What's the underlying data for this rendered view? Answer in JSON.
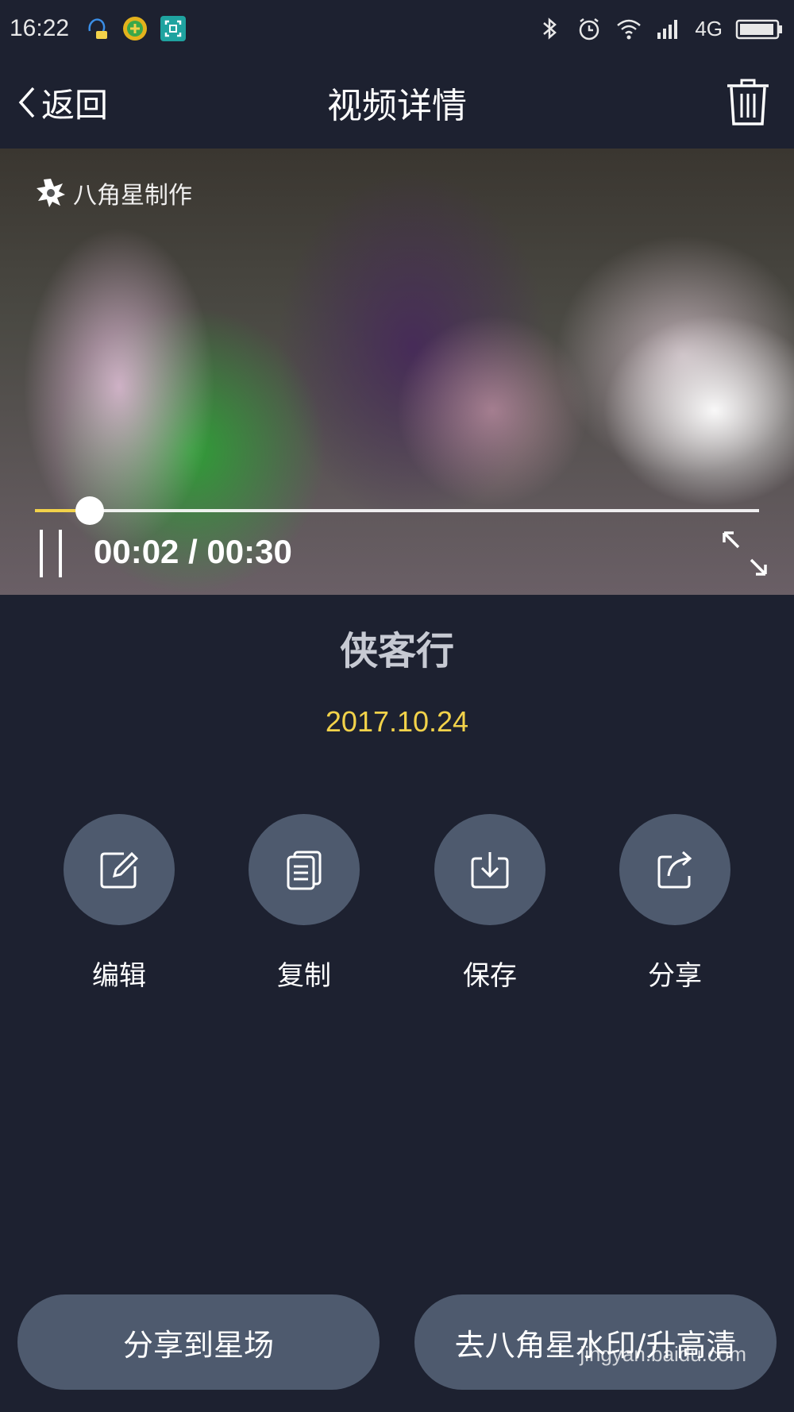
{
  "status_bar": {
    "time": "16:22",
    "left_icons": [
      "chat-bot-icon",
      "plus-app-icon",
      "scan-app-icon"
    ],
    "right_icons": [
      "bluetooth-icon",
      "alarm-icon",
      "wifi-icon",
      "signal-icon",
      "battery-icon"
    ],
    "network": "4G"
  },
  "header": {
    "back_label": "返回",
    "title": "视频详情"
  },
  "video": {
    "watermark": "八角星制作",
    "time_display": "00:02 / 00:30",
    "current": "00:02",
    "total": "00:30",
    "progress": 0.076
  },
  "clip": {
    "title": "侠客行",
    "date": "2017.10.24"
  },
  "actions": [
    {
      "label": "编辑",
      "icon": "edit-icon"
    },
    {
      "label": "复制",
      "icon": "copy-icon"
    },
    {
      "label": "保存",
      "icon": "download-icon"
    },
    {
      "label": "分享",
      "icon": "share-icon"
    }
  ],
  "bottom": {
    "share_plaza": "分享到星场",
    "remove_watermark": "去八角星水印/升高清"
  },
  "site_watermark": "jingyan.baidu.com"
}
